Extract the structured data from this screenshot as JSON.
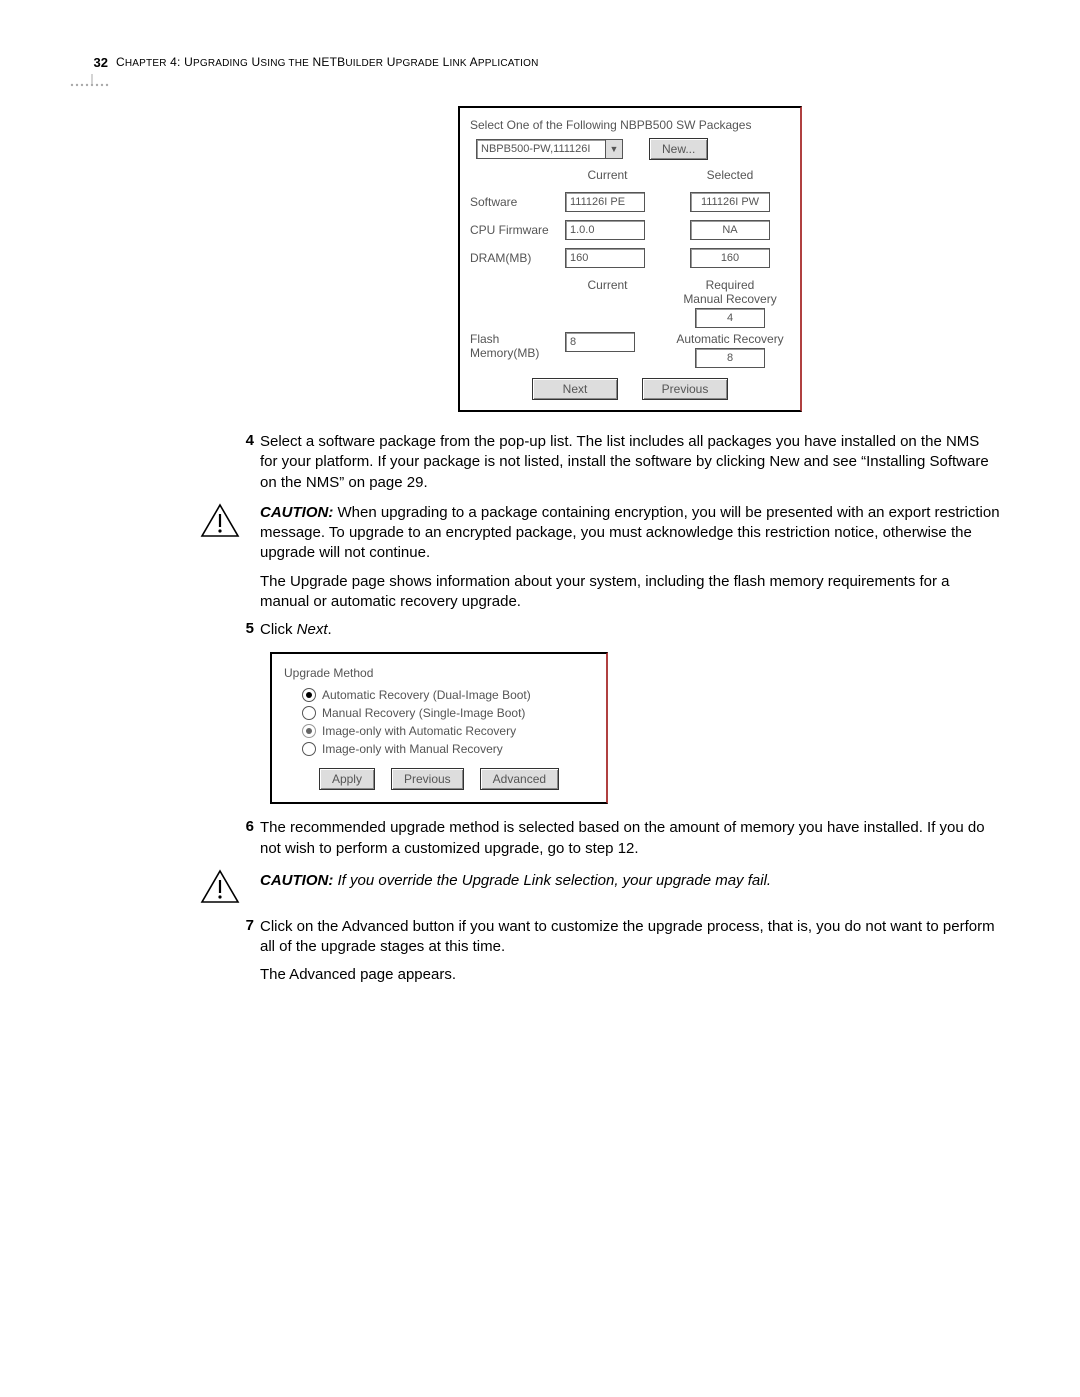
{
  "header": {
    "page_number": "32",
    "chapter_title": "Chapter 4: Upgrading Using the NETBuilder Upgrade Link Application"
  },
  "shot1": {
    "prompt": "Select One of the Following NBPB500 SW Packages",
    "dropdown_value": "NBPB500-PW,111126I",
    "new_btn": "New...",
    "col_current": "Current",
    "col_selected": "Selected",
    "row_software": "Software",
    "row_software_current": "111126I PE",
    "row_software_selected": "111126I PW",
    "row_cpu": "CPU Firmware",
    "row_cpu_current": "1.0.0",
    "row_cpu_selected": "NA",
    "row_dram": "DRAM(MB)",
    "row_dram_current": "160",
    "row_dram_selected": "160",
    "flash_label": "Flash Memory(MB)",
    "flash_current_head": "Current",
    "flash_current_val": "8",
    "required_head": "Required",
    "manual_head": "Manual Recovery",
    "manual_val": "4",
    "auto_head": "Automatic Recovery",
    "auto_val": "8",
    "next_btn": "Next",
    "prev_btn": "Previous"
  },
  "step4": {
    "num": "4",
    "text": "Select a software package from the pop-up list. The list includes all packages you have installed on the NMS for your platform. If your package is not listed, install the software by clicking New and see “Installing Software on the NMS” on page 29."
  },
  "caution1": {
    "label": "CAUTION:",
    "text": "When upgrading to a package containing encryption, you will be presented with an export restriction message. To upgrade to an encrypted package, you must acknowledge this restriction notice, otherwise the upgrade will not continue."
  },
  "upgrade_desc": "The Upgrade page shows information about your system, including the flash memory requirements for a manual or automatic recovery upgrade.",
  "step5": {
    "num": "5",
    "prefix": "Click ",
    "action": "Next",
    "suffix": "."
  },
  "shot2": {
    "title": "Upgrade Method",
    "opt1": "Automatic Recovery (Dual-Image Boot)",
    "opt2": "Manual Recovery (Single-Image Boot)",
    "opt3": "Image-only with Automatic Recovery",
    "opt4": "Image-only with Manual Recovery",
    "apply": "Apply",
    "previous": "Previous",
    "advanced": "Advanced"
  },
  "step6": {
    "num": "6",
    "text": "The recommended upgrade method is selected based on the amount of memory you have installed. If you do not wish to perform a customized upgrade, go to step 12."
  },
  "caution2": {
    "label": "CAUTION:",
    "text": "If you override the Upgrade Link selection, your upgrade may fail."
  },
  "step7": {
    "num": "7",
    "text": "Click on the Advanced button if you want to customize the upgrade process, that is, you do not want to perform all of the upgrade stages at this time."
  },
  "adv_appears": "The Advanced page appears."
}
